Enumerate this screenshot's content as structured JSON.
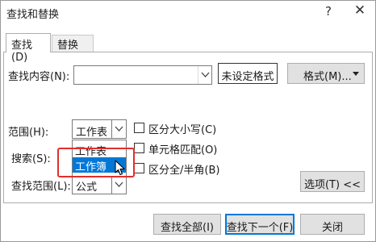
{
  "window": {
    "title": "查找和替换",
    "help_label": "?",
    "close_label": "✕"
  },
  "tabs": [
    {
      "label": "查找(D)",
      "selected": true
    },
    {
      "label": "替换(P)",
      "selected": false
    }
  ],
  "find_what": {
    "label": "查找内容(N):",
    "value": "",
    "format_status": "未设定格式",
    "format_button": "格式(M)..."
  },
  "options": {
    "within_label": "范围(H):",
    "within_value": "工作表",
    "within_dropdown": {
      "items": [
        "工作表",
        "工作簿"
      ],
      "highlighted_index": 1
    },
    "search_label": "搜索(S):",
    "lookin_label": "查找范围(L):",
    "lookin_value": "公式",
    "checkboxes": [
      {
        "label": "区分大小写(C)",
        "checked": false
      },
      {
        "label": "单元格匹配(O)",
        "checked": false
      },
      {
        "label": "区分全/半角(B)",
        "checked": false
      }
    ],
    "options_button": "选项(T) <<"
  },
  "footer": {
    "find_all": "查找全部(I)",
    "find_next": "查找下一个(F)",
    "close": "关闭"
  },
  "colors": {
    "accent": "#0078d7",
    "annotation": "#e0302c"
  },
  "icons": {
    "dropdown": "chevron-down-icon",
    "cursor": "mouse-pointer-icon"
  }
}
